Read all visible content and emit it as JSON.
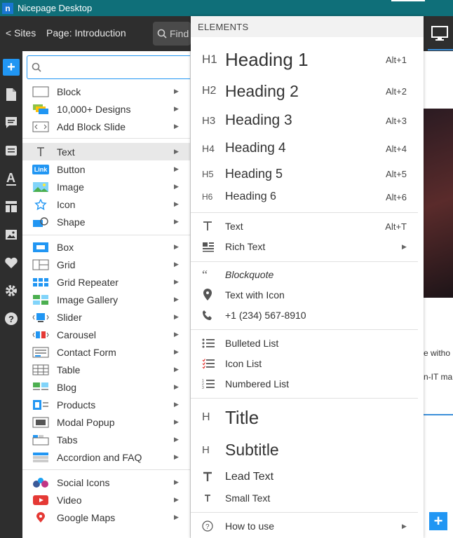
{
  "titlebar": {
    "app_icon": "n",
    "title": "Nicepage Desktop"
  },
  "topbar": {
    "sites": "< Sites",
    "page": "Page: Introduction",
    "find": "Find"
  },
  "search": {
    "value": ""
  },
  "left_menu": {
    "groups": [
      [
        {
          "label": "Block",
          "icon": "block-icon"
        },
        {
          "label": "10,000+ Designs",
          "icon": "designs-icon"
        },
        {
          "label": "Add Block Slide",
          "icon": "block-slide-icon"
        }
      ],
      [
        {
          "label": "Text",
          "icon": "text-icon",
          "active": true
        },
        {
          "label": "Button",
          "icon": "button-icon",
          "badge": "Link"
        },
        {
          "label": "Image",
          "icon": "image-icon"
        },
        {
          "label": "Icon",
          "icon": "star-icon"
        },
        {
          "label": "Shape",
          "icon": "shape-icon"
        }
      ],
      [
        {
          "label": "Box",
          "icon": "box-icon"
        },
        {
          "label": "Grid",
          "icon": "grid-icon"
        },
        {
          "label": "Grid Repeater",
          "icon": "grid-repeater-icon"
        },
        {
          "label": "Image Gallery",
          "icon": "gallery-icon"
        },
        {
          "label": "Slider",
          "icon": "slider-icon"
        },
        {
          "label": "Carousel",
          "icon": "carousel-icon"
        },
        {
          "label": "Contact Form",
          "icon": "form-icon"
        },
        {
          "label": "Table",
          "icon": "table-icon"
        },
        {
          "label": "Blog",
          "icon": "blog-icon"
        },
        {
          "label": "Products",
          "icon": "products-icon"
        },
        {
          "label": "Modal Popup",
          "icon": "popup-icon"
        },
        {
          "label": "Tabs",
          "icon": "tabs-icon"
        },
        {
          "label": "Accordion and FAQ",
          "icon": "accordion-icon"
        }
      ],
      [
        {
          "label": "Social Icons",
          "icon": "social-icon"
        },
        {
          "label": "Video",
          "icon": "video-icon"
        },
        {
          "label": "Google Maps",
          "icon": "map-pin-icon"
        }
      ]
    ]
  },
  "elements_panel": {
    "header": "ELEMENTS",
    "headings": [
      {
        "tag": "H1",
        "label": "Heading 1",
        "shortcut": "Alt+1"
      },
      {
        "tag": "H2",
        "label": "Heading 2",
        "shortcut": "Alt+2"
      },
      {
        "tag": "H3",
        "label": "Heading 3",
        "shortcut": "Alt+3"
      },
      {
        "tag": "H4",
        "label": "Heading 4",
        "shortcut": "Alt+4"
      },
      {
        "tag": "H5",
        "label": "Heading 5",
        "shortcut": "Alt+5"
      },
      {
        "tag": "H6",
        "label": "Heading 6",
        "shortcut": "Alt+6"
      }
    ],
    "text": {
      "label": "Text",
      "shortcut": "Alt+T"
    },
    "rich_text": "Rich Text",
    "blockquote": "Blockquote",
    "text_with_icon": "Text with Icon",
    "phone": "+1 (234) 567-8910",
    "bulleted_list": "Bulleted List",
    "icon_list": "Icon List",
    "numbered_list": "Numbered List",
    "title": "Title",
    "subtitle": "Subtitle",
    "lead_text": "Lead Text",
    "small_text": "Small Text",
    "how_to_use": "How to use"
  },
  "canvas": {
    "line1": "e witho",
    "line2": "n-IT ma"
  },
  "colors": {
    "titlebar": "#0f6f79",
    "accent": "#2196f3",
    "dark": "#2e2e2e"
  }
}
